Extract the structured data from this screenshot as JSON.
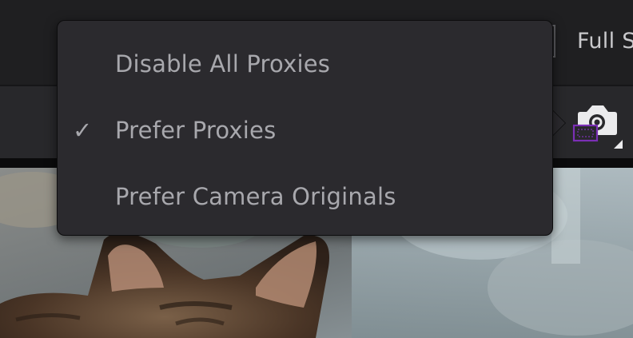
{
  "toolbar": {
    "full_screen_label": "Full S"
  },
  "proxy_menu": {
    "items": [
      {
        "label": "Disable All Proxies",
        "checked": false
      },
      {
        "label": "Prefer Proxies",
        "checked": true
      },
      {
        "label": "Prefer Camera Originals",
        "checked": false
      }
    ],
    "check_glyph": "✓"
  },
  "proxy_button": {
    "icon": "camera-proxy-icon",
    "accent_color": "#7b2fb5"
  },
  "viewer": {
    "image_subject": "cat-ears"
  }
}
